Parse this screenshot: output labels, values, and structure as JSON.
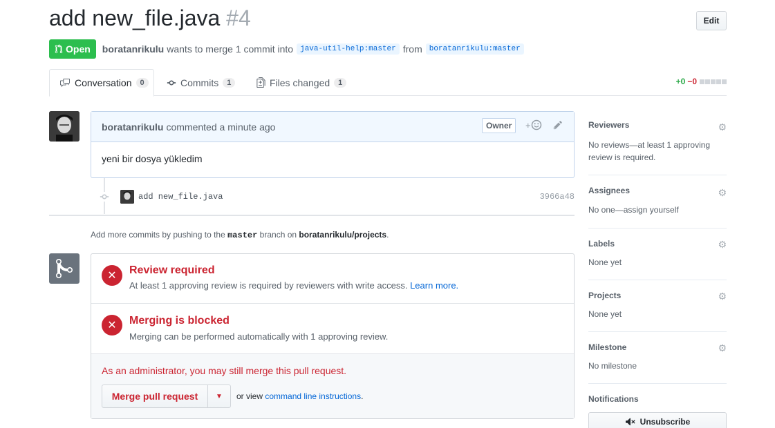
{
  "header": {
    "title": "add new_file.java",
    "number": "#4",
    "edit_label": "Edit",
    "state_label": "Open",
    "author": "boratanrikulu",
    "merge_text": "wants to merge 1 commit into",
    "base_ref": "java-util-help:master",
    "from_text": "from",
    "head_ref": "boratanrikulu:master"
  },
  "tabs": [
    {
      "label": "Conversation",
      "count": "0",
      "icon": "comment-discussion-icon"
    },
    {
      "label": "Commits",
      "count": "1",
      "icon": "git-commit-icon"
    },
    {
      "label": "Files changed",
      "count": "1",
      "icon": "diff-icon"
    }
  ],
  "diffstat": {
    "additions": "+0",
    "deletions": "−0"
  },
  "comment": {
    "author": "boratanrikulu",
    "action": "commented",
    "time": "a minute ago",
    "owner_label": "Owner",
    "body": "yeni bir dosya yükledim"
  },
  "commit": {
    "message": "add new_file.java",
    "sha": "3966a48"
  },
  "push_hint": {
    "prefix": "Add more commits by pushing to the",
    "branch": "master",
    "middle": "branch on",
    "repo": "boratanrikulu/projects",
    "suffix": "."
  },
  "merge": {
    "review_title": "Review required",
    "review_desc": "At least 1 approving review is required by reviewers with write access.",
    "learn_more": "Learn more.",
    "blocked_title": "Merging is blocked",
    "blocked_desc": "Merging can be performed automatically with 1 approving review.",
    "admin_msg": "As an administrator, you may still merge this pull request.",
    "merge_button": "Merge pull request",
    "or_view": "or view",
    "cli_link": "command line instructions",
    "period": "."
  },
  "sidebar": {
    "reviewers": {
      "title": "Reviewers",
      "text": "No reviews—at least 1 approving review is required."
    },
    "assignees": {
      "title": "Assignees",
      "text": "No one—assign yourself"
    },
    "labels": {
      "title": "Labels",
      "text": "None yet"
    },
    "projects": {
      "title": "Projects",
      "text": "None yet"
    },
    "milestone": {
      "title": "Milestone",
      "text": "No milestone"
    },
    "notifications": {
      "title": "Notifications",
      "button": "Unsubscribe"
    }
  },
  "colors": {
    "open_green": "#2cbe4e",
    "error_red": "#cb2431",
    "link_blue": "#0366d6"
  }
}
